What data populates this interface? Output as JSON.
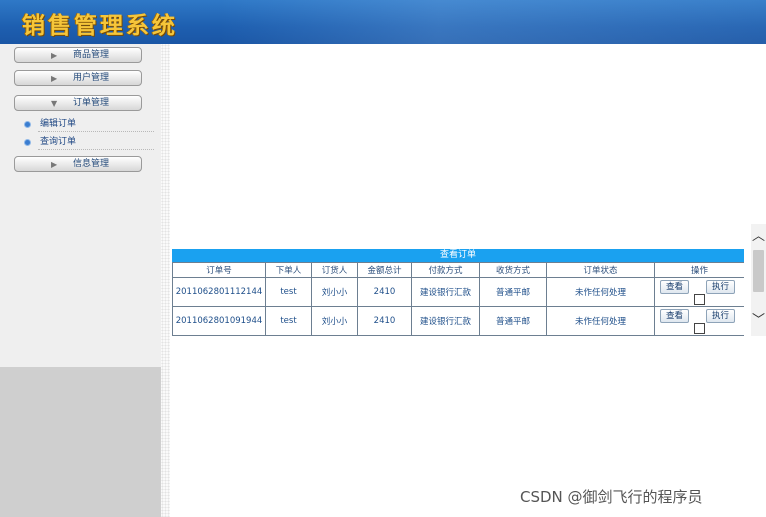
{
  "app": {
    "title": "销售管理系统"
  },
  "sidebar": {
    "menus": [
      {
        "label": "商品管理",
        "expanded": false
      },
      {
        "label": "用户管理",
        "expanded": false
      },
      {
        "label": "订单管理",
        "expanded": true
      },
      {
        "label": "信息管理",
        "expanded": false
      }
    ],
    "order_sub_items": [
      {
        "label": "编辑订单"
      },
      {
        "label": "查询订单"
      }
    ]
  },
  "table": {
    "title": "查看订单",
    "headers": [
      "订单号",
      "下单人",
      "订货人",
      "金额总计",
      "付款方式",
      "收货方式",
      "订单状态",
      "操作"
    ],
    "rows": [
      {
        "order_no": "2011062801112144",
        "buyer": "test",
        "receiver": "刘小小",
        "total": "2410",
        "payment": "建设银行汇款",
        "delivery": "普通平邮",
        "status": "未作任何处理",
        "view_label": "查看",
        "exec_label": "执行"
      },
      {
        "order_no": "2011062801091944",
        "buyer": "test",
        "receiver": "刘小小",
        "total": "2410",
        "payment": "建设银行汇款",
        "delivery": "普通平邮",
        "status": "未作任何处理",
        "view_label": "查看",
        "exec_label": "执行"
      }
    ]
  },
  "scrollbar": {
    "up_icon": "chevron-up-icon",
    "down_icon": "chevron-down-icon"
  },
  "watermark": "CSDN @御剑飞行的程序员",
  "colors": {
    "header": "#1e5fb0",
    "table_title": "#1aa1f0",
    "title_text": "#f6c63a"
  }
}
